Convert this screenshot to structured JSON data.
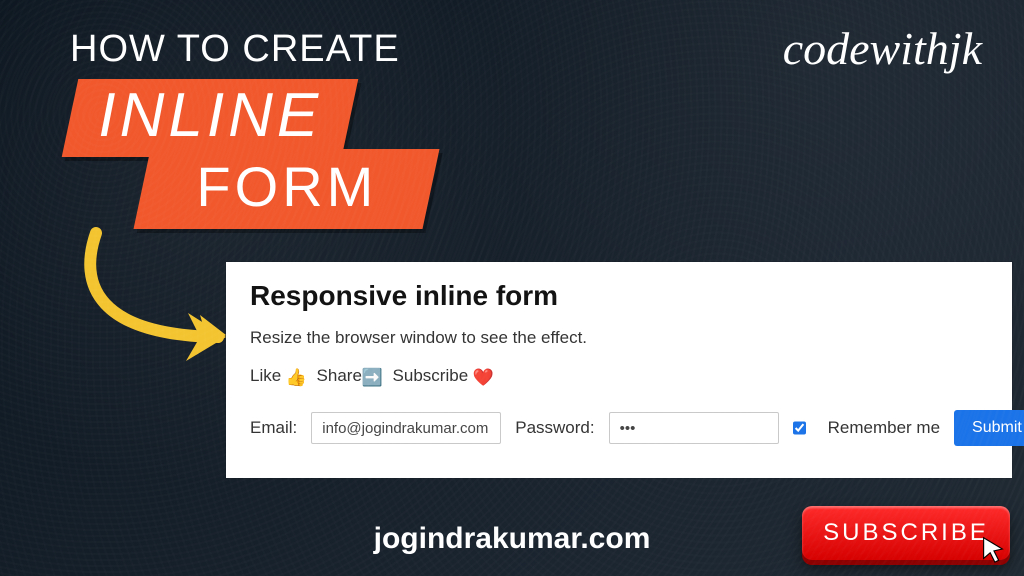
{
  "brand": "codewithjk",
  "title": {
    "line1": "How to Create",
    "inline": "INLINE",
    "form": "FORM"
  },
  "card": {
    "heading": "Responsive inline form",
    "lead": "Resize the browser window to see the effect.",
    "social": {
      "like": "Like",
      "share": "Share",
      "subscribe": "Subscribe"
    },
    "form": {
      "email_label": "Email:",
      "email_value": "info@jogindrakumar.com",
      "password_label": "Password:",
      "password_value": "•••",
      "remember_checked": true,
      "remember_label": "Remember me",
      "submit_label": "Submit"
    }
  },
  "footer_url": "jogindrakumar.com",
  "subscribe_label": "SUBSCRIBE"
}
